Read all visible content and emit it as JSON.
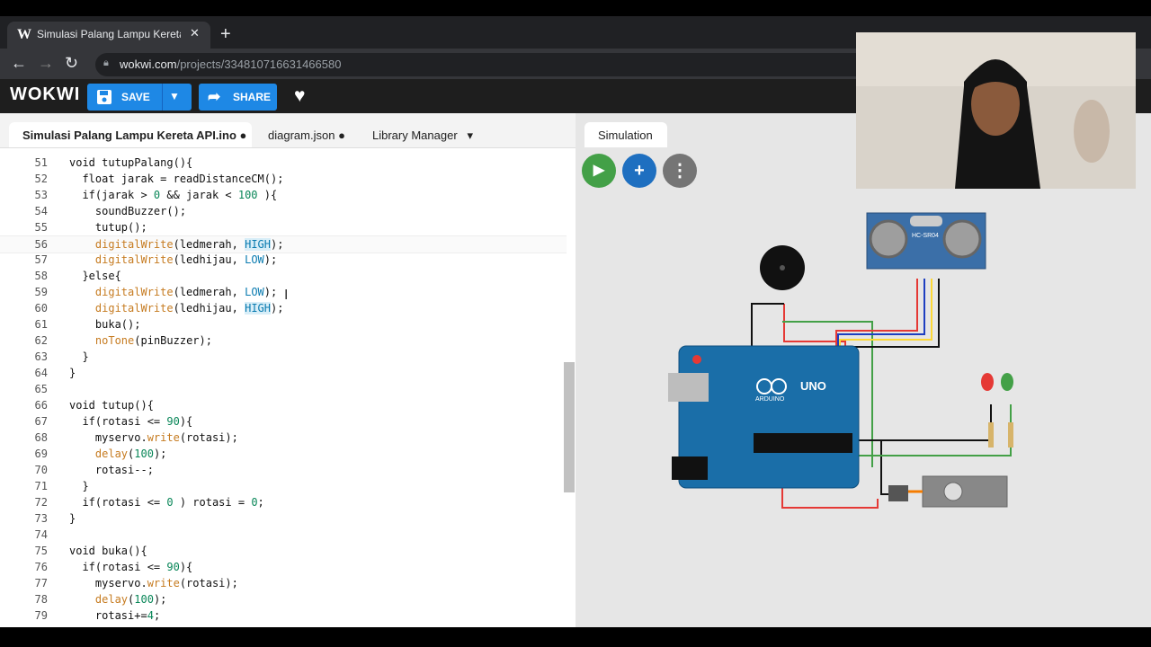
{
  "browser": {
    "tab_title": "Simulasi Palang Lampu Kereta API",
    "tab_icon_letter": "W",
    "url_domain": "wokwi.com",
    "url_path": "/projects/334810716631466580"
  },
  "wokwi": {
    "logo": "WOKWI",
    "save_label": "SAVE",
    "share_label": "SHARE"
  },
  "editor": {
    "tabs": [
      {
        "label": "Simulasi Palang Lampu Kereta API.ino",
        "modified": "●"
      },
      {
        "label": "diagram.json",
        "modified": "●"
      },
      {
        "label": "Library Manager",
        "dropdown": "▾"
      }
    ]
  },
  "simulation": {
    "tab_label": "Simulation",
    "play_label": "▶",
    "add_label": "+",
    "more_label": "⋮",
    "sensor_label": "HC-SR04",
    "board_label": "UNO",
    "board_brand": "ARDUINO"
  },
  "colors": {
    "accent": "#1e88e5",
    "play": "#43a047",
    "board": "#1a6ea8"
  }
}
